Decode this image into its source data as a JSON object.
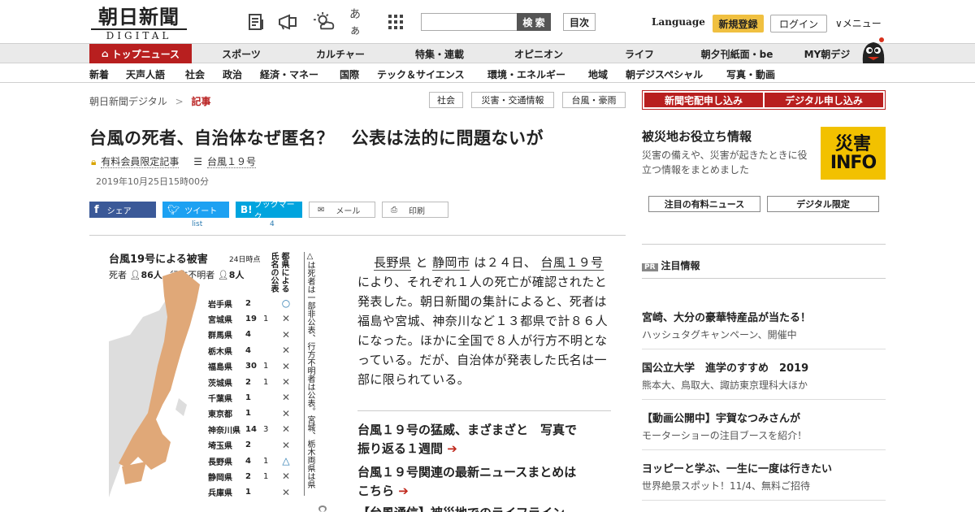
{
  "header": {
    "logo_jp": "朝日新聞",
    "logo_en": "DIGITAL",
    "search_placeholder": "",
    "search_button": "検 索",
    "toc_button": "目次",
    "language": "Language",
    "signup": "新規登録",
    "login": "ログイン",
    "menu": "∨メニュー",
    "icons": [
      "newspaper-icon",
      "megaphone-icon",
      "weather-icon",
      "font-size-icon",
      "grid-icon"
    ],
    "font_size_glyph": "あぁ"
  },
  "nav_main": [
    "トップニュース",
    "スポーツ",
    "カルチャー",
    "特集・連載",
    "オピニオン",
    "ライフ",
    "朝夕刊紙面・be",
    "MY朝デジ"
  ],
  "nav_sub": [
    "新着",
    "天声人語",
    "社会",
    "政治",
    "経済・マネー",
    "国際",
    "テック＆サイエンス",
    "環境・エネルギー",
    "地域",
    "朝デジスペシャル",
    "写真・動画"
  ],
  "breadcrumb": {
    "home": "朝日新聞デジタル",
    "sep": ">",
    "current": "記事"
  },
  "tags": [
    "社会",
    "災害・交通情報",
    "台風・豪雨"
  ],
  "article": {
    "title": "台風の死者、自治体なぜ匿名？　公表は法的に問題ないが",
    "paid_label": "有料会員限定記事",
    "series_label": "台風１９号",
    "date": "2019年10月25日15時00分",
    "share": {
      "facebook": "シェア",
      "twitter": "ツイート",
      "twitter_count": "list",
      "hatena": "ブックマーク",
      "hatena_count": "4",
      "mail": "メール",
      "print": "印刷"
    },
    "body_parts": [
      "長野県",
      " と ",
      "静岡市",
      " は２４日、 ",
      "台風１９号",
      " により、それぞれ１人の死亡が確認されたと発表した。朝日新聞の集計によると、死者は福島や宮城、神奈川など１３都県で計８６人になった。ほかに全国で８人が行方不明となっている。だが、自治体が発表した氏名は一部に限られている。"
    ],
    "related": [
      {
        "line1": "台風１９号の猛威、まざまざと　写真で",
        "line2": "振り返る１週間"
      },
      {
        "line1": "台風１９号関連の最新ニュースまとめは",
        "line2": "こちら"
      }
    ],
    "arrow": "➔",
    "related3_partial": "【台風通信】被災地でのライフライン…"
  },
  "infographic": {
    "title": "台風19号による被害",
    "as_of": "24日時点",
    "dead_label": "死者",
    "dead_count": "86人",
    "missing_label": "行方不明者",
    "missing_count": "8人",
    "col_header": "都県による氏名の公表",
    "note": "△は死者は一部非公表、行方不明者は公表。宮城、栃木両県は県警が公表",
    "rows": [
      {
        "pref": "岩手県",
        "dead": "2",
        "missing": "",
        "mark": "○"
      },
      {
        "pref": "宮城県",
        "dead": "19",
        "missing": "1",
        "mark": "✕"
      },
      {
        "pref": "群馬県",
        "dead": "4",
        "missing": "",
        "mark": "✕"
      },
      {
        "pref": "栃木県",
        "dead": "4",
        "missing": "",
        "mark": "✕"
      },
      {
        "pref": "福島県",
        "dead": "30",
        "missing": "1",
        "mark": "✕"
      },
      {
        "pref": "茨城県",
        "dead": "2",
        "missing": "1",
        "mark": "✕"
      },
      {
        "pref": "千葉県",
        "dead": "1",
        "missing": "",
        "mark": "✕"
      },
      {
        "pref": "東京都",
        "dead": "1",
        "missing": "",
        "mark": "✕"
      },
      {
        "pref": "神奈川県",
        "dead": "14",
        "missing": "3",
        "mark": "✕"
      },
      {
        "pref": "埼玉県",
        "dead": "2",
        "missing": "",
        "mark": "✕"
      },
      {
        "pref": "長野県",
        "dead": "4",
        "missing": "1",
        "mark": "△"
      },
      {
        "pref": "静岡県",
        "dead": "2",
        "missing": "1",
        "mark": "✕"
      },
      {
        "pref": "兵庫県",
        "dead": "1",
        "missing": "",
        "mark": "✕"
      }
    ]
  },
  "sidebar": {
    "subscribe_buttons": [
      "新聞宅配申し込み",
      "デジタル申し込み"
    ],
    "disaster_title": "被災地お役立ち情報",
    "disaster_desc": "災害の備えや、災害が起きたときに役立つ情報をまとめました",
    "disaster_logo_top": "災害",
    "disaster_logo_bottom": "INFO",
    "tabs": [
      "注目の有料ニュース",
      "デジタル限定"
    ],
    "pr_badge": "PR",
    "pr_header": "注目情報",
    "pr_items": [
      {
        "title": "宮崎、大分の豪華特産品が当たる！",
        "sub": "ハッシュタグキャンペーン、開催中"
      },
      {
        "title": "国公立大学　進学のすすめ　2019",
        "sub": "熊本大、鳥取大、諏訪東京理科大ほか"
      },
      {
        "title": "【動画公開中】宇賀なつみさんが",
        "sub": "モーターショーの注目ブースを紹介！"
      },
      {
        "title": "ヨッピーと学ぶ、一生に一度は行きたい",
        "sub": "世界絶景スポット！11/4、無料ご招待"
      }
    ]
  },
  "colors": {
    "brand_red": "#b81f1f",
    "accent_yellow": "#f0c040",
    "facebook": "#3b5998",
    "twitter": "#1da1f2",
    "hatena": "#00a4de"
  }
}
